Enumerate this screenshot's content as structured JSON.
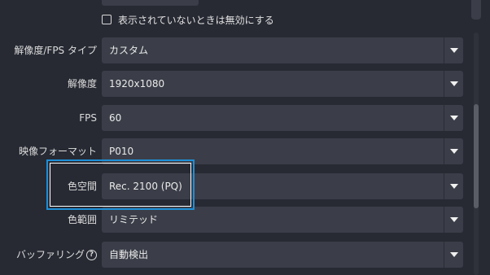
{
  "checkbox": {
    "label": "表示されていないときは無効にする",
    "checked": false
  },
  "settings": [
    {
      "label": "解像度/FPS タイプ",
      "value": "カスタム",
      "help": false
    },
    {
      "label": "解像度",
      "value": "1920x1080",
      "help": false
    },
    {
      "label": "FPS",
      "value": "60",
      "help": false
    },
    {
      "label": "映像フォーマット",
      "value": "P010",
      "help": false
    },
    {
      "label": "色空間",
      "value": "Rec. 2100 (PQ)",
      "help": false
    },
    {
      "label": "色範囲",
      "value": "リミテッド",
      "help": false
    },
    {
      "label": "バッファリング",
      "value": "自動検出",
      "help": true
    }
  ],
  "help_icon_glyph": "?",
  "colors": {
    "background": "#272a33",
    "control": "#3b3e48",
    "highlight": "#1e8fd8"
  }
}
